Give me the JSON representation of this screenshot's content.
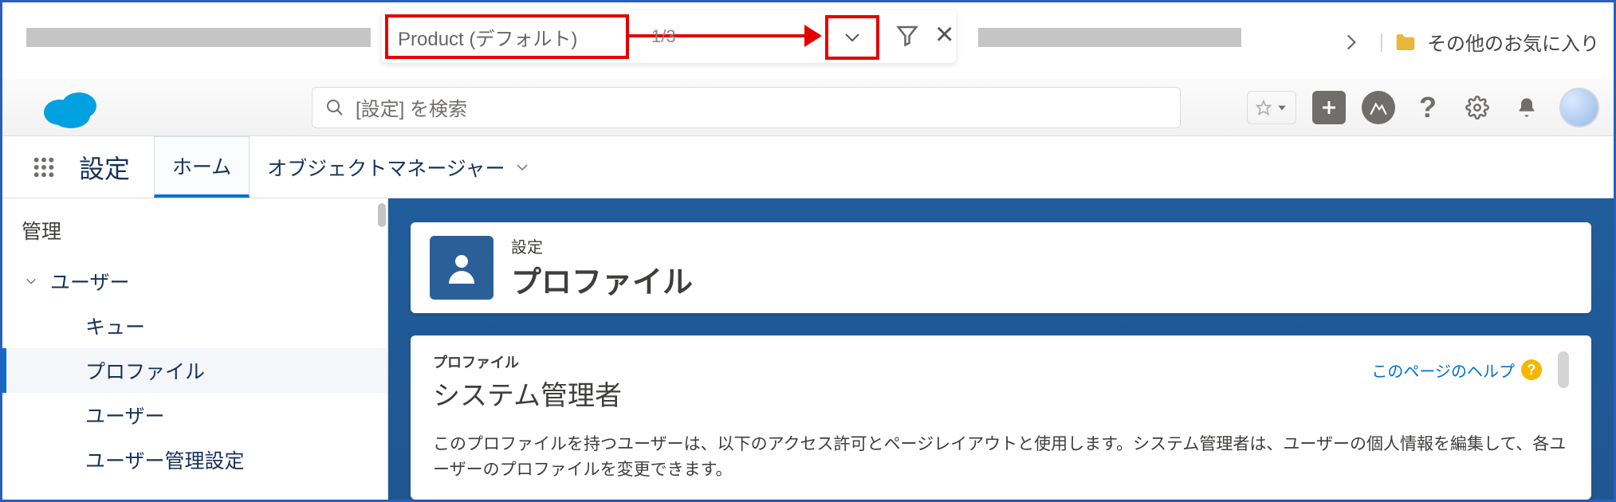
{
  "browser_findbar": {
    "value": "Product (デフォルト)",
    "count": "1/3"
  },
  "favorites": {
    "label": "その他のお気に入り"
  },
  "sf_header": {
    "search_placeholder": "[設定] を検索"
  },
  "subnav": {
    "title": "設定",
    "tab_home": "ホーム",
    "tab_object_manager": "オブジェクトマネージャー"
  },
  "sidebar": {
    "section": "管理",
    "items": [
      {
        "label": "ユーザー"
      },
      {
        "label": "キュー"
      },
      {
        "label": "プロファイル"
      },
      {
        "label": "ユーザー"
      },
      {
        "label": "ユーザー管理設定"
      }
    ]
  },
  "page_header": {
    "kicker": "設定",
    "title": "プロファイル"
  },
  "profile_card": {
    "label": "プロファイル",
    "name": "システム管理者",
    "help_link": "このページのヘルプ",
    "description": "このプロファイルを持つユーザーは、以下のアクセス許可とページレイアウトと使用します。システム管理者は、ユーザーの個人情報を編集して、各ユーザーのプロファイルを変更できます。"
  }
}
